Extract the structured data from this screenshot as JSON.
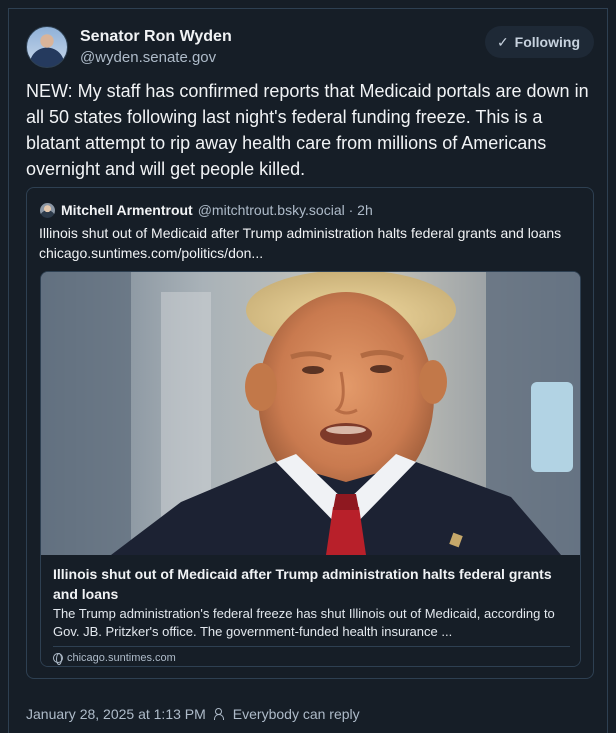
{
  "post": {
    "author_name": "Senator Ron Wyden",
    "author_handle": "@wyden.senate.gov",
    "follow_label": "Following",
    "follow_icon": "check-icon",
    "text": "NEW: My staff has confirmed reports that Medicaid portals are down in all 50 states following last night's federal funding freeze. This is a blatant attempt to rip away health care from millions of Americans overnight and will get people killed.",
    "timestamp": "January 28, 2025 at 1:13 PM",
    "reply_setting": "Everybody can reply"
  },
  "quote": {
    "author_name": "Mitchell Armentrout",
    "author_handle": "@mitchtrout.bsky.social",
    "separator": "·",
    "age": "2h",
    "text": "Illinois shut out of Medicaid after Trump administration halts federal grants and loans chicago.suntimes.com/politics/don...",
    "card": {
      "title": "Illinois shut out of Medicaid after Trump administration halts federal grants and loans",
      "description": "The Trump administration's federal freeze has shut Illinois out of Medicaid, according to Gov. JB. Pritzker's office. The government-funded health insurance ...",
      "source": "chicago.suntimes.com"
    }
  },
  "colors": {
    "background": "#161e27",
    "border": "#2e4052",
    "text_primary": "#f1f3f5",
    "text_secondary": "#aebbc9",
    "button_bg": "#1e2936"
  }
}
